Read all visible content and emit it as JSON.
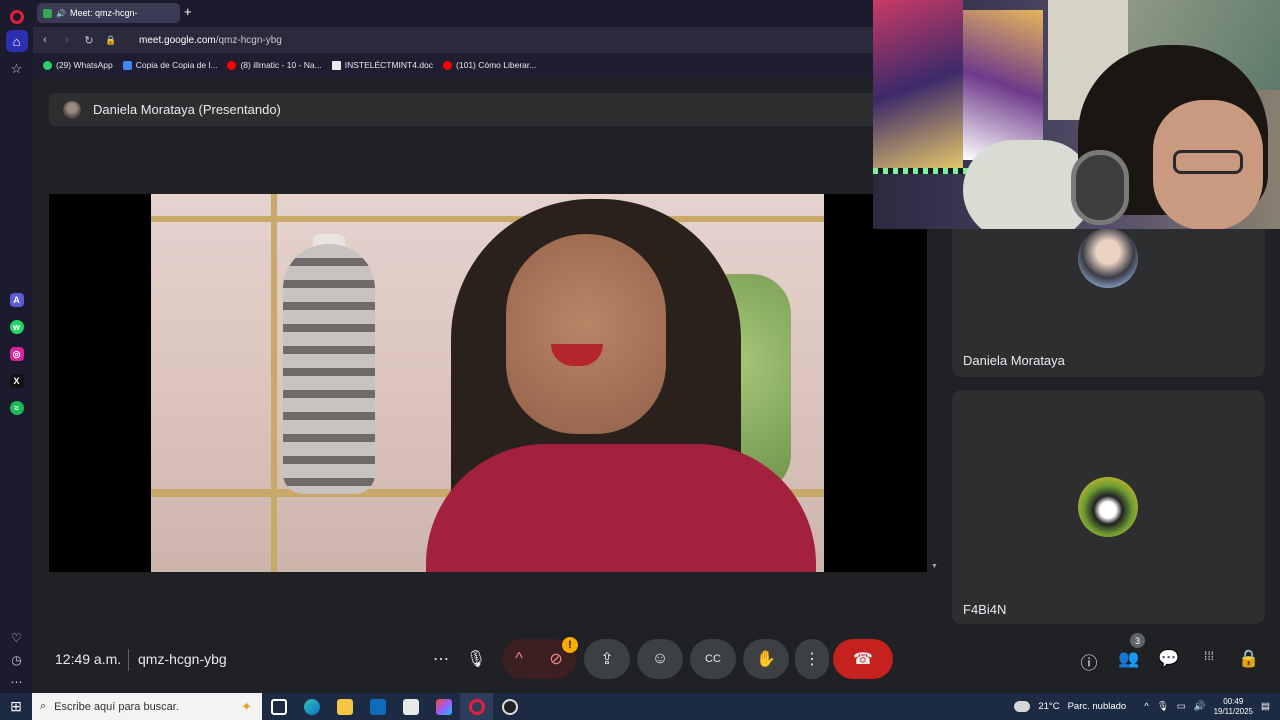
{
  "browser": {
    "tab_title": "Meet: qmz-hcgn-",
    "new_tab_glyph": "+",
    "url_domain": "meet.google.com",
    "url_path": "/qmz-hcgn-ybg",
    "bookmarks": [
      {
        "label": "(29) WhatsApp",
        "color": "#25d366"
      },
      {
        "label": "Copia de Copia de l...",
        "color": "#4285f4"
      },
      {
        "label": "(8) illmatic - 10 - Na...",
        "color": "#ff0000"
      },
      {
        "label": "INSTELÉCTMINT4.doc",
        "color": "#e8eaed"
      },
      {
        "label": "(101) Cómo Liberar...",
        "color": "#ff0000"
      }
    ]
  },
  "meet": {
    "presenter_label": "Daniela Morataya (Presentando)",
    "participants": [
      {
        "name": "Daniela Morataya"
      },
      {
        "name": "F4Bi4N"
      }
    ],
    "clock": "12:49 a.m.",
    "meeting_code": "qmz-hcgn-ybg",
    "warning_badge": "!",
    "participant_count": "3"
  },
  "taskbar": {
    "search_placeholder": "Escribe aquí para buscar.",
    "temperature": "21°C",
    "weather": "Parc. nublado",
    "time": "00:49",
    "date": "19/11/2025"
  },
  "icons": {
    "menu_more": "⋯",
    "mic": "🎙",
    "chevron_up": "^",
    "camera_off": "⊘",
    "present": "⇪",
    "emoji": "☺",
    "captions": "CC",
    "raise_hand": "✋",
    "more_vert": "⋮",
    "hangup": "☎",
    "info": "ⓘ",
    "people": "👥",
    "chat": "💬",
    "activities": "⁞⁞⁞",
    "host_controls": "🔒"
  },
  "colors": {
    "opera_red": "#e0203c",
    "hangup_red": "#c5221f",
    "meet_bg": "#202124",
    "warning": "#f9ab00"
  }
}
